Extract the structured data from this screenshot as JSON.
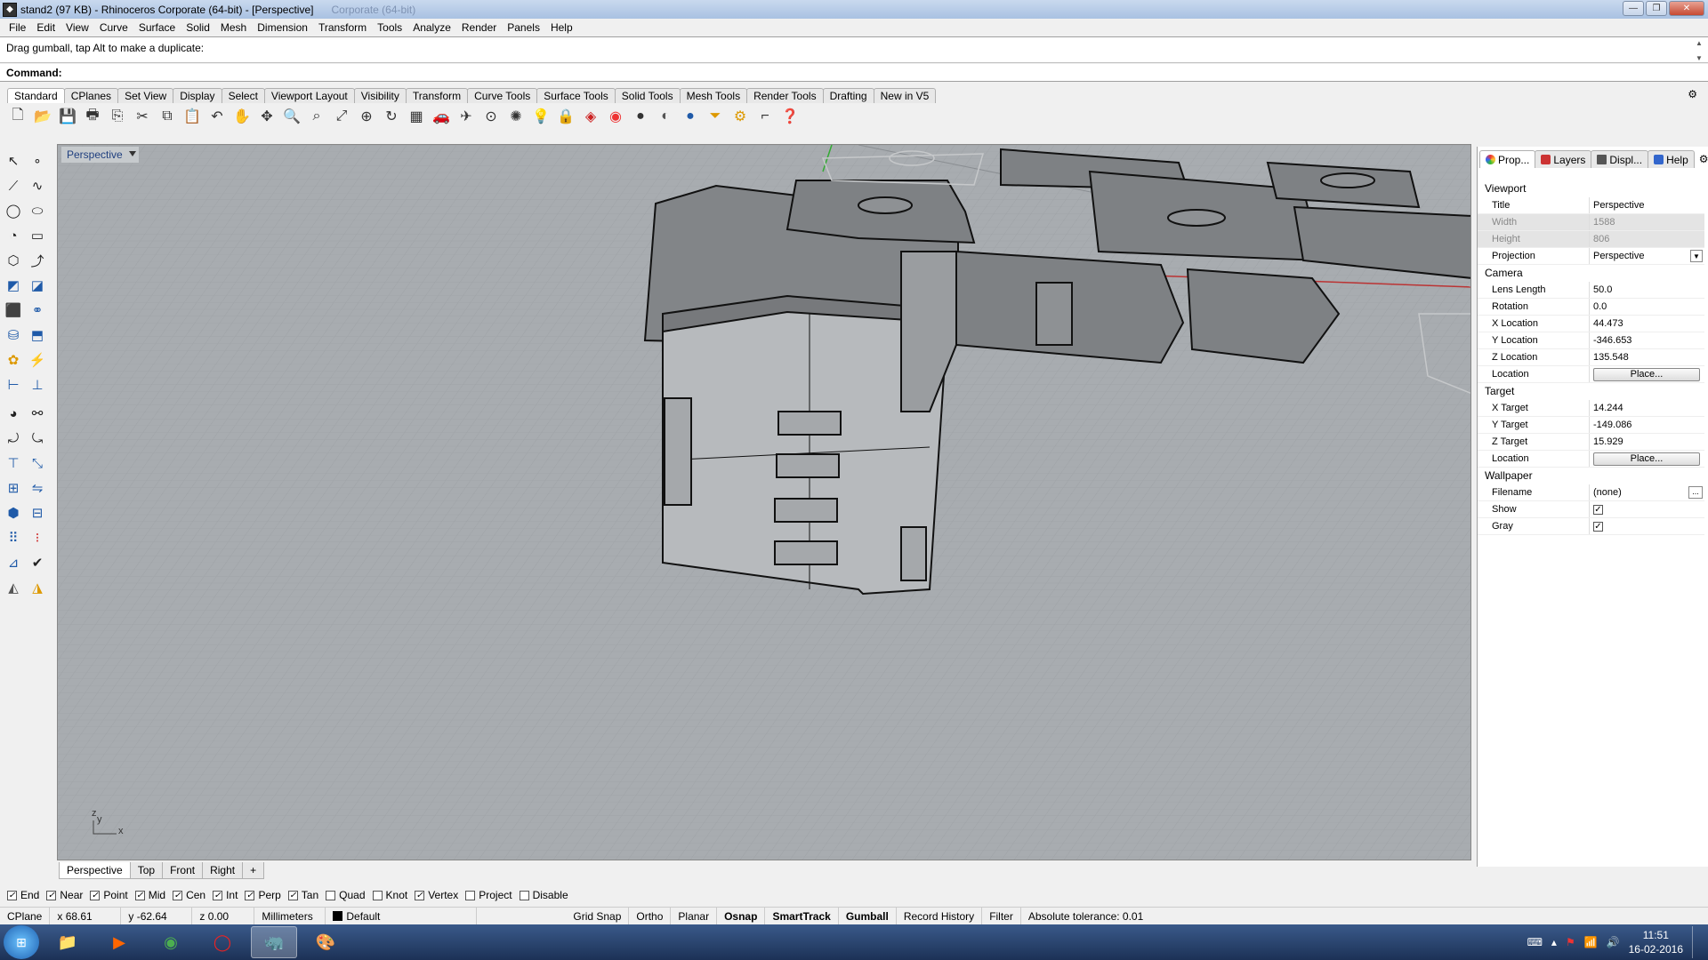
{
  "window": {
    "title": "stand2 (97 KB) - Rhinoceros Corporate (64-bit) - [Perspective]",
    "ghost_title": "Corporate (64-bit)"
  },
  "menu": [
    "File",
    "Edit",
    "View",
    "Curve",
    "Surface",
    "Solid",
    "Mesh",
    "Dimension",
    "Transform",
    "Tools",
    "Analyze",
    "Render",
    "Panels",
    "Help"
  ],
  "command": {
    "history": "Drag gumball, tap Alt to make a duplicate:",
    "label": "Command:",
    "value": ""
  },
  "toolbar_tabs": [
    "Standard",
    "CPlanes",
    "Set View",
    "Display",
    "Select",
    "Viewport Layout",
    "Visibility",
    "Transform",
    "Curve Tools",
    "Surface Tools",
    "Solid Tools",
    "Mesh Tools",
    "Render Tools",
    "Drafting",
    "New in V5"
  ],
  "toolbar_icons": [
    "new-icon",
    "open-icon",
    "save-icon",
    "print-icon",
    "import-icon",
    "cut-icon",
    "copy-icon",
    "paste-icon",
    "undo-icon",
    "pan-icon",
    "rotate-view-icon",
    "zoom-icon",
    "zoom-window-icon",
    "zoom-extents-icon",
    "zoom-selected-icon",
    "zoom-target-icon",
    "grid-icon",
    "car-icon",
    "plane-icon",
    "point-icon",
    "lightbulb-icon",
    "lock-icon",
    "layer-icon",
    "color-wheel-icon",
    "sphere-icon",
    "shaded-sphere-icon",
    "render-sphere-icon",
    "funnel-icon",
    "gear-icon",
    "dimension-icon",
    "help-icon"
  ],
  "viewport": {
    "name": "Perspective",
    "axis_z": "z",
    "axis_y": "y",
    "axis_x": "x",
    "background": "#a8acb0"
  },
  "viewport_tabs": [
    "Perspective",
    "Top",
    "Front",
    "Right",
    "+"
  ],
  "panel": {
    "tabs": [
      "Prop...",
      "Layers",
      "Displ...",
      "Help"
    ],
    "viewport_section": "Viewport",
    "title_label": "Title",
    "title_value": "Perspective",
    "width_label": "Width",
    "width_value": "1588",
    "height_label": "Height",
    "height_value": "806",
    "projection_label": "Projection",
    "projection_value": "Perspective",
    "camera_section": "Camera",
    "lens_label": "Lens Length",
    "lens_value": "50.0",
    "rotation_label": "Rotation",
    "rotation_value": "0.0",
    "xloc_label": "X Location",
    "xloc_value": "44.473",
    "yloc_label": "Y Location",
    "yloc_value": "-346.653",
    "zloc_label": "Z Location",
    "zloc_value": "135.548",
    "camloc_label": "Location",
    "place_label": "Place...",
    "target_section": "Target",
    "xt_label": "X Target",
    "xt_value": "14.244",
    "yt_label": "Y Target",
    "yt_value": "-149.086",
    "zt_label": "Z Target",
    "zt_value": "15.929",
    "tloc_label": "Location",
    "wallpaper_section": "Wallpaper",
    "filename_label": "Filename",
    "filename_value": "(none)",
    "show_label": "Show",
    "gray_label": "Gray"
  },
  "osnap": [
    {
      "label": "End",
      "checked": true
    },
    {
      "label": "Near",
      "checked": true
    },
    {
      "label": "Point",
      "checked": true
    },
    {
      "label": "Mid",
      "checked": true
    },
    {
      "label": "Cen",
      "checked": true
    },
    {
      "label": "Int",
      "checked": true
    },
    {
      "label": "Perp",
      "checked": true
    },
    {
      "label": "Tan",
      "checked": true
    },
    {
      "label": "Quad",
      "checked": false
    },
    {
      "label": "Knot",
      "checked": false
    },
    {
      "label": "Vertex",
      "checked": true
    },
    {
      "label": "Project",
      "checked": false
    },
    {
      "label": "Disable",
      "checked": false
    }
  ],
  "status": {
    "cplane": "CPlane",
    "x": "x 68.61",
    "y": "y -62.64",
    "z": "z 0.00",
    "units": "Millimeters",
    "layer": "Default",
    "grid_snap": "Grid Snap",
    "ortho": "Ortho",
    "planar": "Planar",
    "osnap": "Osnap",
    "smarttrack": "SmartTrack",
    "gumball": "Gumball",
    "record_history": "Record History",
    "filter": "Filter",
    "tolerance": "Absolute tolerance: 0.01"
  },
  "taskbar": {
    "time": "11:51",
    "date": "16-02-2016"
  }
}
